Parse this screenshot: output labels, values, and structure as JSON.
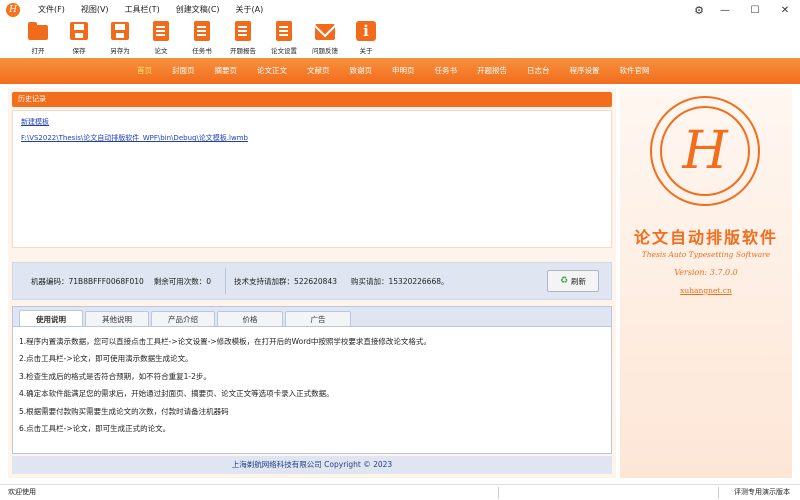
{
  "window": {
    "logo_letter": "H",
    "menu": [
      "文件(F)",
      "视图(V)",
      "工具栏(T)",
      "创建文稿(C)",
      "关于(A)"
    ],
    "controls": {
      "settings": "⚙",
      "minimize": "—",
      "maximize": "☐",
      "close": "✕"
    }
  },
  "toolbar": [
    {
      "label": "打开",
      "icon": "folder-icon"
    },
    {
      "label": "保存",
      "icon": "save-icon"
    },
    {
      "label": "另存为",
      "icon": "save-as-icon"
    },
    {
      "label": "论文",
      "icon": "document-icon"
    },
    {
      "label": "任务书",
      "icon": "document-icon"
    },
    {
      "label": "开题报告",
      "icon": "document-icon"
    },
    {
      "label": "论文设置",
      "icon": "document-icon"
    },
    {
      "label": "问题反馈",
      "icon": "mail-icon"
    },
    {
      "label": "关于",
      "icon": "info-icon"
    }
  ],
  "nav": [
    "首页",
    "封面页",
    "摘要页",
    "论文正文",
    "文献页",
    "致谢页",
    "申明页",
    "任务书",
    "开题报告",
    "日志台",
    "程序设置",
    "软件官网"
  ],
  "nav_active": 0,
  "history": {
    "title": "历史记录",
    "items": [
      "新建模板",
      "F:\\VS2022\\Thesis\\论文自动排版软件_WPF\\bin\\Debug\\论文模板.lwmb"
    ]
  },
  "info": {
    "machine": "机器编码：71B8BFFF0068F010",
    "remaining": "剩余可用次数：0",
    "support": "技术支持请加群：522620843",
    "purchase": "购买请加：15320226668。",
    "refresh": "刷新"
  },
  "tabs": [
    "使用说明",
    "其他说明",
    "产品介绍",
    "价格",
    "广告"
  ],
  "tab_active": 0,
  "steps": [
    "1.程序内置演示数据，您可以直接点击工具栏->论文设置->修改模板，在打开后的Word中按照学校要求直接修改论文格式。",
    "2.点击工具栏->论文，即可使用演示数据生成论文。",
    "3.检查生成后的格式是否符合预期，如不符合重复1-2步。",
    "4.确定本软件能满足您的需求后，开始通过封面页、摘要页、论文正文等选项卡录入正式数据。",
    "5.根据需要付款购买需要生成论文的次数，付款时请备注机器码",
    "6.点击工具栏->论文，即可生成正式的论文。"
  ],
  "copyright": "上海剃航网络科技有限公司 Copyright © 2023",
  "brand": {
    "monogram": "H",
    "name_cn": "论文自动排版软件",
    "name_en": "Thesis Auto Typesetting Software",
    "version": "Version: 3.7.0.0",
    "site": "xuhangnet.cn"
  },
  "status": {
    "left": "欢迎使用",
    "right": "评测专用演示版本"
  },
  "colors": {
    "accent": "#f26d1c",
    "nav_active": "#ffe57a"
  }
}
